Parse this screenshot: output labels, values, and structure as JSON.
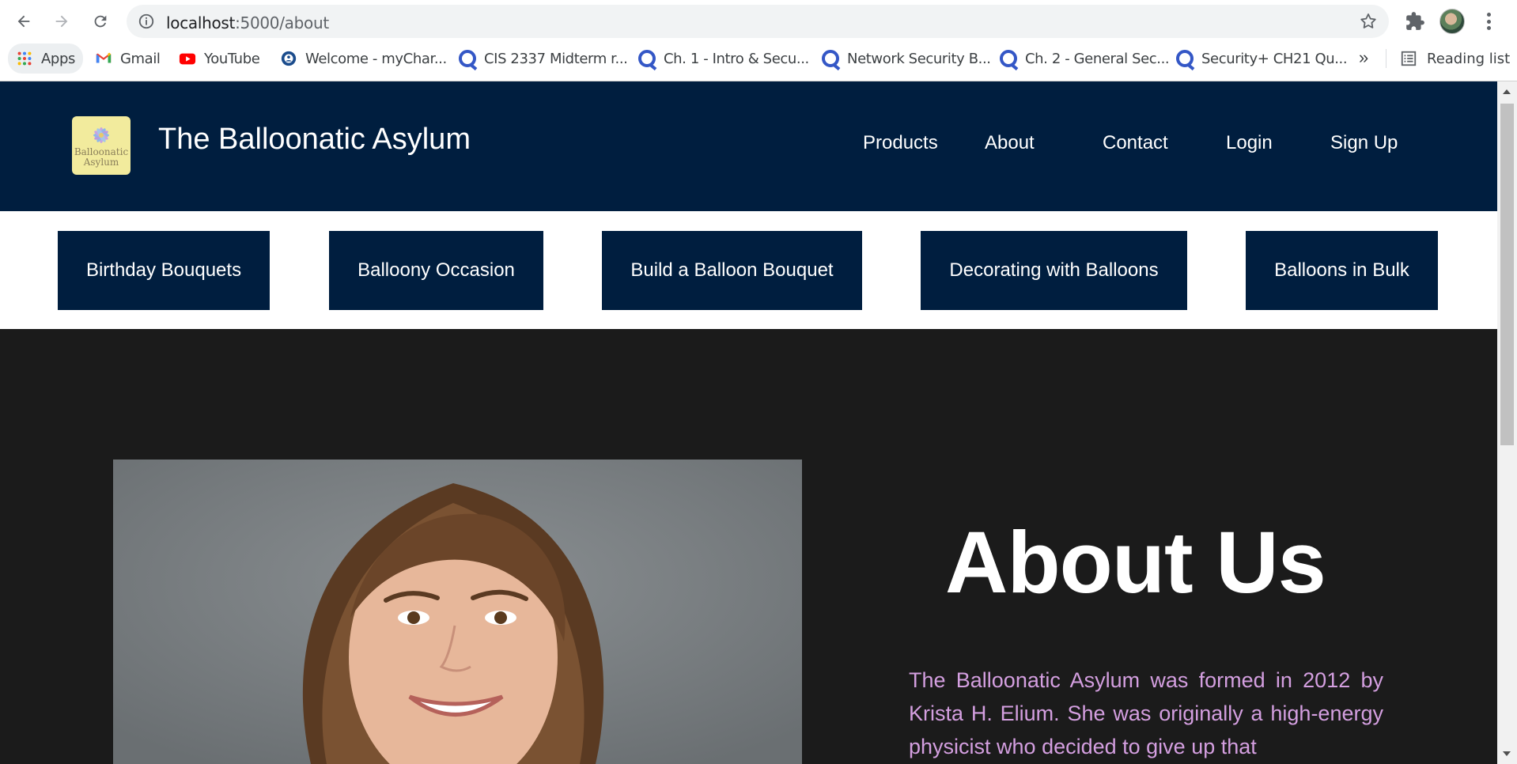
{
  "browser": {
    "url_host": "localhost",
    "url_path": ":5000/about",
    "bookmarks": [
      {
        "label": "Apps",
        "icon": "apps-grid-icon"
      },
      {
        "label": "Gmail",
        "icon": "gmail-icon"
      },
      {
        "label": "YouTube",
        "icon": "youtube-icon"
      },
      {
        "label": "Welcome - myChar...",
        "icon": "mychart-icon"
      },
      {
        "label": "CIS 2337 Midterm r...",
        "icon": "quizlet-icon"
      },
      {
        "label": "Ch. 1 - Intro & Secu...",
        "icon": "quizlet-icon"
      },
      {
        "label": "Network Security B...",
        "icon": "quizlet-icon"
      },
      {
        "label": "Ch. 2 - General Sec...",
        "icon": "quizlet-icon"
      },
      {
        "label": "Security+ CH21 Qu...",
        "icon": "quizlet-icon"
      }
    ],
    "overflow_label": "»",
    "reading_list_label": "Reading list"
  },
  "header": {
    "logo_line1": "Balloonatic",
    "logo_line2": "Asylum",
    "title": "The Balloonatic Asylum",
    "nav": [
      "Products",
      "About",
      "Contact",
      "Login",
      "Sign Up"
    ]
  },
  "categories": [
    "Birthday Bouquets",
    "Balloony Occasion",
    "Build a Balloon Bouquet",
    "Decorating with Balloons",
    "Balloons in Bulk"
  ],
  "about": {
    "heading": "About Us",
    "paragraph": "The Balloonatic Asylum was formed in 2012 by Krista H. Elium. She was originally a high-energy physicist who decided to give up that"
  },
  "colors": {
    "navy": "#001e3f",
    "dark_bg": "#1b1b1b",
    "paragraph_text": "#d49fe0",
    "logo_bg": "#f2eb9d"
  }
}
